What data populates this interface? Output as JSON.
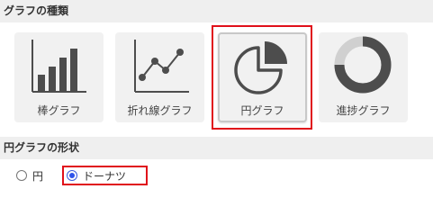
{
  "section_chart_type": {
    "title": "グラフの種類"
  },
  "chart_types": [
    {
      "label": "棒グラフ",
      "icon": "bar-chart-icon"
    },
    {
      "label": "折れ線グラフ",
      "icon": "line-chart-icon"
    },
    {
      "label": "円グラフ",
      "icon": "pie-chart-icon",
      "selected": true
    },
    {
      "label": "進捗グラフ",
      "icon": "progress-donut-icon"
    }
  ],
  "section_pie_shape": {
    "title": "円グラフの形状"
  },
  "pie_shape_options": [
    {
      "label": "円",
      "checked": false
    },
    {
      "label": "ドーナツ",
      "checked": true
    }
  ],
  "colors": {
    "icon": "#4d4d4d",
    "highlight": "#e0101a",
    "radio_accent": "#2f54eb",
    "donut_track": "#d0d0d0"
  }
}
